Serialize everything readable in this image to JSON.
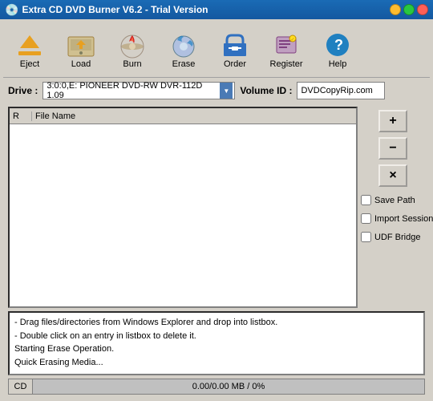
{
  "titleBar": {
    "title": "Extra CD DVD Burner V6.2 - Trial Version",
    "icon": "💿"
  },
  "toolbar": {
    "buttons": [
      {
        "id": "eject",
        "label": "Eject",
        "color": "#e8a020"
      },
      {
        "id": "load",
        "label": "Load",
        "color": "#e8a020"
      },
      {
        "id": "burn",
        "label": "Burn",
        "color": "#cc2020"
      },
      {
        "id": "erase",
        "label": "Erase",
        "color": "#2080c0"
      },
      {
        "id": "order",
        "label": "Order",
        "color": "#3070c0"
      },
      {
        "id": "register",
        "label": "Register",
        "color": "#804080"
      },
      {
        "id": "help",
        "label": "Help",
        "color": "#2080c0"
      }
    ]
  },
  "driveRow": {
    "driveLabel": "Drive :",
    "driveValue": "3:0:0,E: PIONEER  DVD-RW  DVR-112D 1.09",
    "volumeIdLabel": "Volume ID :",
    "volumeIdValue": "DVDCopyRip.com"
  },
  "fileList": {
    "headers": {
      "r": "R",
      "name": "File Name"
    },
    "rows": []
  },
  "checkboxes": {
    "savePath": "Save Path",
    "importSession": "Import Session",
    "udfBridge": "UDF Bridge"
  },
  "actionButtons": {
    "add": "+",
    "remove": "−",
    "clear": "×"
  },
  "log": {
    "lines": [
      "- Drag files/directories from Windows Explorer and drop into listbox.",
      "- Double click on an entry in listbox to delete it.",
      "Starting Erase Operation.",
      "Quick Erasing Media..."
    ]
  },
  "progressBar": {
    "label": "CD",
    "value": "0.00/0.00 MB / 0%",
    "percent": 0
  }
}
